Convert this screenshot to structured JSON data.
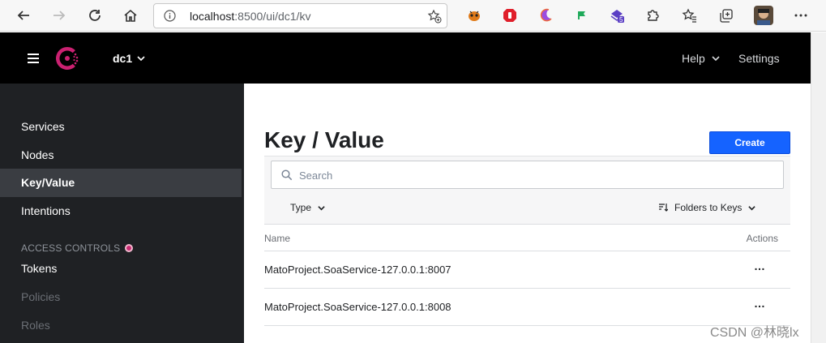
{
  "browser": {
    "url_host": "localhost",
    "url_rest": ":8500/ui/dc1/kv",
    "extension_badge": "5"
  },
  "header": {
    "datacenter": "dc1",
    "help_label": "Help",
    "settings_label": "Settings"
  },
  "sidebar": {
    "items": [
      {
        "label": "Services"
      },
      {
        "label": "Nodes"
      },
      {
        "label": "Key/Value",
        "active": true
      },
      {
        "label": "Intentions"
      }
    ],
    "section_label": "ACCESS CONTROLS",
    "acl_items": [
      {
        "label": "Tokens"
      },
      {
        "label": "Policies",
        "disabled": true
      },
      {
        "label": "Roles",
        "disabled": true
      }
    ]
  },
  "main": {
    "title": "Key / Value",
    "create_label": "Create",
    "search_placeholder": "Search",
    "type_filter_label": "Type",
    "sort_label": "Folders to Keys",
    "columns": {
      "name": "Name",
      "actions": "Actions"
    },
    "rows": [
      {
        "key": "MatoProject.SoaService-127.0.0.1:8007",
        "actions": "…"
      },
      {
        "key": "MatoProject.SoaService-127.0.0.1:8008",
        "actions": "…"
      }
    ]
  },
  "watermark": "CSDN @林晓lx",
  "colors": {
    "brand": "#ca2171",
    "primary_button": "#1563ff",
    "header_bg": "#000000",
    "sidebar_bg": "#1f2124"
  }
}
